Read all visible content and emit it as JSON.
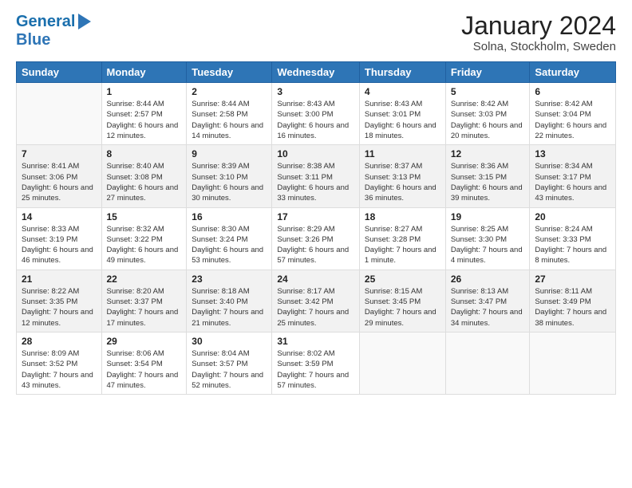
{
  "logo": {
    "line1": "General",
    "line2": "Blue"
  },
  "title": "January 2024",
  "subtitle": "Solna, Stockholm, Sweden",
  "weekdays": [
    "Sunday",
    "Monday",
    "Tuesday",
    "Wednesday",
    "Thursday",
    "Friday",
    "Saturday"
  ],
  "weeks": [
    [
      {
        "day": "",
        "sunrise": "",
        "sunset": "",
        "daylight": ""
      },
      {
        "day": "1",
        "sunrise": "Sunrise: 8:44 AM",
        "sunset": "Sunset: 2:57 PM",
        "daylight": "Daylight: 6 hours and 12 minutes."
      },
      {
        "day": "2",
        "sunrise": "Sunrise: 8:44 AM",
        "sunset": "Sunset: 2:58 PM",
        "daylight": "Daylight: 6 hours and 14 minutes."
      },
      {
        "day": "3",
        "sunrise": "Sunrise: 8:43 AM",
        "sunset": "Sunset: 3:00 PM",
        "daylight": "Daylight: 6 hours and 16 minutes."
      },
      {
        "day": "4",
        "sunrise": "Sunrise: 8:43 AM",
        "sunset": "Sunset: 3:01 PM",
        "daylight": "Daylight: 6 hours and 18 minutes."
      },
      {
        "day": "5",
        "sunrise": "Sunrise: 8:42 AM",
        "sunset": "Sunset: 3:03 PM",
        "daylight": "Daylight: 6 hours and 20 minutes."
      },
      {
        "day": "6",
        "sunrise": "Sunrise: 8:42 AM",
        "sunset": "Sunset: 3:04 PM",
        "daylight": "Daylight: 6 hours and 22 minutes."
      }
    ],
    [
      {
        "day": "7",
        "sunrise": "Sunrise: 8:41 AM",
        "sunset": "Sunset: 3:06 PM",
        "daylight": "Daylight: 6 hours and 25 minutes."
      },
      {
        "day": "8",
        "sunrise": "Sunrise: 8:40 AM",
        "sunset": "Sunset: 3:08 PM",
        "daylight": "Daylight: 6 hours and 27 minutes."
      },
      {
        "day": "9",
        "sunrise": "Sunrise: 8:39 AM",
        "sunset": "Sunset: 3:10 PM",
        "daylight": "Daylight: 6 hours and 30 minutes."
      },
      {
        "day": "10",
        "sunrise": "Sunrise: 8:38 AM",
        "sunset": "Sunset: 3:11 PM",
        "daylight": "Daylight: 6 hours and 33 minutes."
      },
      {
        "day": "11",
        "sunrise": "Sunrise: 8:37 AM",
        "sunset": "Sunset: 3:13 PM",
        "daylight": "Daylight: 6 hours and 36 minutes."
      },
      {
        "day": "12",
        "sunrise": "Sunrise: 8:36 AM",
        "sunset": "Sunset: 3:15 PM",
        "daylight": "Daylight: 6 hours and 39 minutes."
      },
      {
        "day": "13",
        "sunrise": "Sunrise: 8:34 AM",
        "sunset": "Sunset: 3:17 PM",
        "daylight": "Daylight: 6 hours and 43 minutes."
      }
    ],
    [
      {
        "day": "14",
        "sunrise": "Sunrise: 8:33 AM",
        "sunset": "Sunset: 3:19 PM",
        "daylight": "Daylight: 6 hours and 46 minutes."
      },
      {
        "day": "15",
        "sunrise": "Sunrise: 8:32 AM",
        "sunset": "Sunset: 3:22 PM",
        "daylight": "Daylight: 6 hours and 49 minutes."
      },
      {
        "day": "16",
        "sunrise": "Sunrise: 8:30 AM",
        "sunset": "Sunset: 3:24 PM",
        "daylight": "Daylight: 6 hours and 53 minutes."
      },
      {
        "day": "17",
        "sunrise": "Sunrise: 8:29 AM",
        "sunset": "Sunset: 3:26 PM",
        "daylight": "Daylight: 6 hours and 57 minutes."
      },
      {
        "day": "18",
        "sunrise": "Sunrise: 8:27 AM",
        "sunset": "Sunset: 3:28 PM",
        "daylight": "Daylight: 7 hours and 1 minute."
      },
      {
        "day": "19",
        "sunrise": "Sunrise: 8:25 AM",
        "sunset": "Sunset: 3:30 PM",
        "daylight": "Daylight: 7 hours and 4 minutes."
      },
      {
        "day": "20",
        "sunrise": "Sunrise: 8:24 AM",
        "sunset": "Sunset: 3:33 PM",
        "daylight": "Daylight: 7 hours and 8 minutes."
      }
    ],
    [
      {
        "day": "21",
        "sunrise": "Sunrise: 8:22 AM",
        "sunset": "Sunset: 3:35 PM",
        "daylight": "Daylight: 7 hours and 12 minutes."
      },
      {
        "day": "22",
        "sunrise": "Sunrise: 8:20 AM",
        "sunset": "Sunset: 3:37 PM",
        "daylight": "Daylight: 7 hours and 17 minutes."
      },
      {
        "day": "23",
        "sunrise": "Sunrise: 8:18 AM",
        "sunset": "Sunset: 3:40 PM",
        "daylight": "Daylight: 7 hours and 21 minutes."
      },
      {
        "day": "24",
        "sunrise": "Sunrise: 8:17 AM",
        "sunset": "Sunset: 3:42 PM",
        "daylight": "Daylight: 7 hours and 25 minutes."
      },
      {
        "day": "25",
        "sunrise": "Sunrise: 8:15 AM",
        "sunset": "Sunset: 3:45 PM",
        "daylight": "Daylight: 7 hours and 29 minutes."
      },
      {
        "day": "26",
        "sunrise": "Sunrise: 8:13 AM",
        "sunset": "Sunset: 3:47 PM",
        "daylight": "Daylight: 7 hours and 34 minutes."
      },
      {
        "day": "27",
        "sunrise": "Sunrise: 8:11 AM",
        "sunset": "Sunset: 3:49 PM",
        "daylight": "Daylight: 7 hours and 38 minutes."
      }
    ],
    [
      {
        "day": "28",
        "sunrise": "Sunrise: 8:09 AM",
        "sunset": "Sunset: 3:52 PM",
        "daylight": "Daylight: 7 hours and 43 minutes."
      },
      {
        "day": "29",
        "sunrise": "Sunrise: 8:06 AM",
        "sunset": "Sunset: 3:54 PM",
        "daylight": "Daylight: 7 hours and 47 minutes."
      },
      {
        "day": "30",
        "sunrise": "Sunrise: 8:04 AM",
        "sunset": "Sunset: 3:57 PM",
        "daylight": "Daylight: 7 hours and 52 minutes."
      },
      {
        "day": "31",
        "sunrise": "Sunrise: 8:02 AM",
        "sunset": "Sunset: 3:59 PM",
        "daylight": "Daylight: 7 hours and 57 minutes."
      },
      {
        "day": "",
        "sunrise": "",
        "sunset": "",
        "daylight": ""
      },
      {
        "day": "",
        "sunrise": "",
        "sunset": "",
        "daylight": ""
      },
      {
        "day": "",
        "sunrise": "",
        "sunset": "",
        "daylight": ""
      }
    ]
  ]
}
